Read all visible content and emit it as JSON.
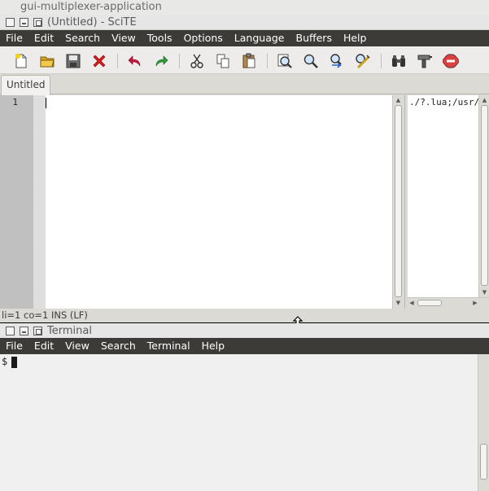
{
  "outer_title": "gui-multiplexer-application",
  "scite": {
    "title": "(Untitled) - SciTE",
    "menu": [
      "File",
      "Edit",
      "Search",
      "View",
      "Tools",
      "Options",
      "Language",
      "Buffers",
      "Help"
    ],
    "toolbar_icons": [
      "new-file-icon",
      "open-folder-icon",
      "save-icon",
      "close-icon",
      "undo-icon",
      "redo-icon",
      "cut-icon",
      "copy-icon",
      "paste-icon",
      "find-icon",
      "find-next-icon",
      "replace-icon",
      "find-in-files-icon",
      "binoculars-icon",
      "compile-icon",
      "stop-icon"
    ],
    "tab": "Untitled",
    "line_number": "1",
    "output_text": "./?.lua;/usr/",
    "status": "li=1 co=1 INS (LF)"
  },
  "terminal": {
    "title": "Terminal",
    "menu": [
      "File",
      "Edit",
      "View",
      "Search",
      "Terminal",
      "Help"
    ],
    "prompt": "$"
  },
  "colors": {
    "menubar": "#3c3b37",
    "gutter": "#c0c0c0",
    "terminal_bg": "#f0f0f0"
  }
}
